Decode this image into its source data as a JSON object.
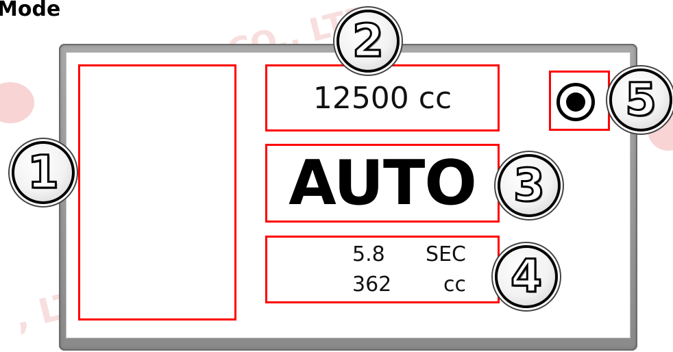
{
  "header": {
    "title": "Mode"
  },
  "watermark": {
    "text_top": "CO., LTD",
    "text_bottom": ", LTD"
  },
  "display": {
    "volume_text": "12500 cc",
    "mode_text": "AUTO",
    "stats": [
      {
        "value": "5.8",
        "unit": "SEC"
      },
      {
        "value": "362",
        "unit": "cc"
      }
    ],
    "record_icon": "record-icon"
  },
  "callouts": [
    "1",
    "2",
    "3",
    "4",
    "5"
  ],
  "colors": {
    "highlight_box": "#ff0000",
    "bezel": "#9a9a9a",
    "screen": "#ffffff"
  }
}
